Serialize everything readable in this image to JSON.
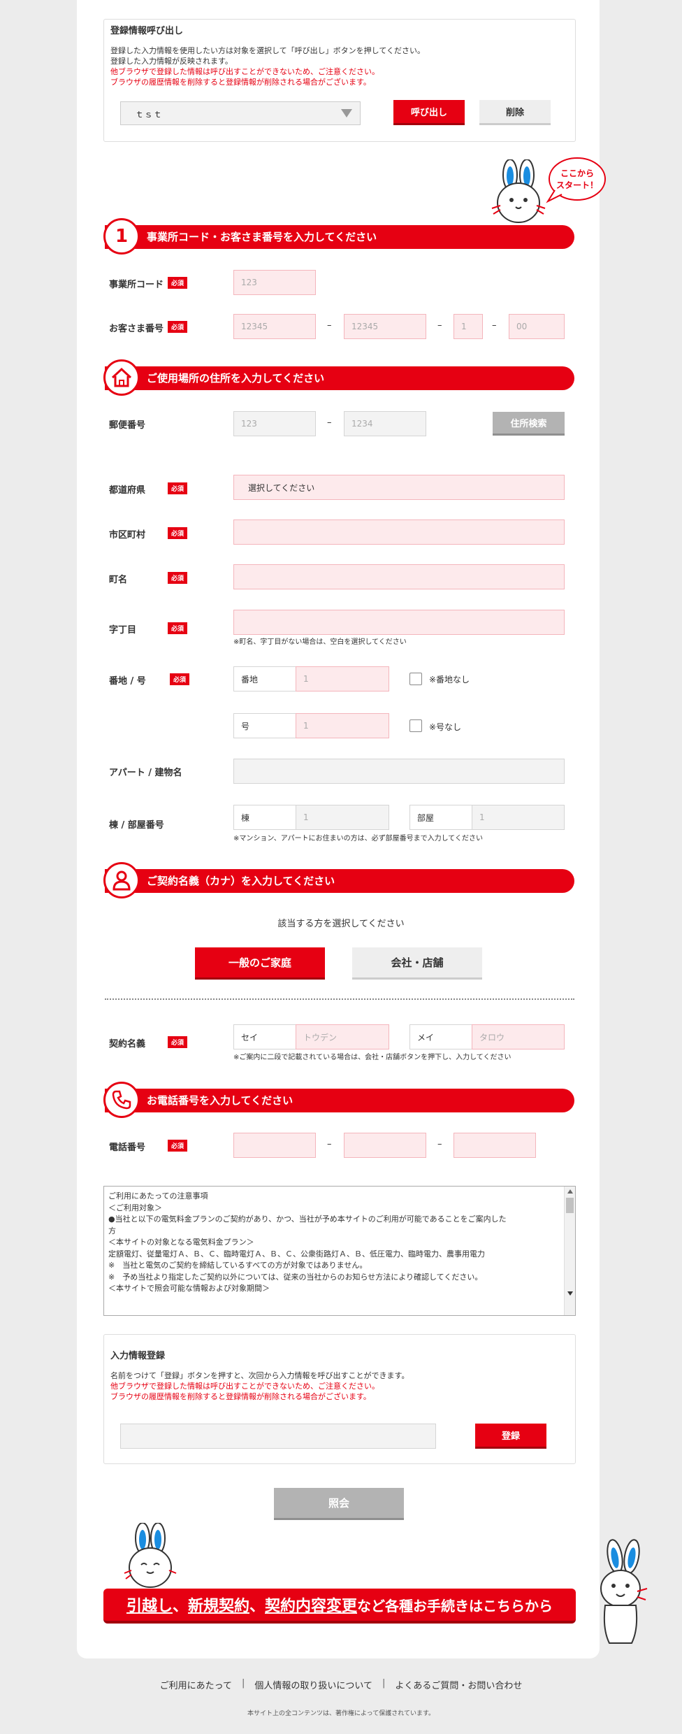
{
  "recall": {
    "title": "登録情報呼び出し",
    "note_black_1": "登録した入力情報を使用したい方は対象を選択して「呼び出し」ボタンを押してください。",
    "note_black_2": "登録した入力情報が反映されます。",
    "note_red_1": "他ブラウザで登録した情報は呼び出すことができないため、ご注意ください。",
    "note_red_2": "ブラウザの履歴情報を削除すると登録情報が削除される場合がございます。",
    "select_value": "ｔｓｔ",
    "call_button": "呼び出し",
    "delete_button": "削除"
  },
  "bubble": {
    "line1": "ここから",
    "line2": "スタート！"
  },
  "sections": {
    "s1": {
      "num": "1",
      "title": "事業所コード・お客さま番号を入力してください"
    },
    "s2": {
      "title": "ご使用場所の住所を入力してください"
    },
    "s3": {
      "title": "ご契約名義（カナ）を入力してください"
    },
    "s4": {
      "title": "お電話番号を入力してください"
    }
  },
  "required_badge": "必須",
  "dash": "–",
  "office": {
    "label": "事業所コード",
    "placeholder": "123"
  },
  "customer": {
    "label": "お客さま番号",
    "p1": "12345",
    "p2": "12345",
    "p3": "1",
    "p4": "00"
  },
  "postal": {
    "label": "郵便番号",
    "p1": "123",
    "p2": "1234",
    "search_button": "住所検索"
  },
  "prefecture": {
    "label": "都道府県",
    "value": "選択してください"
  },
  "city": {
    "label": "市区町村"
  },
  "town": {
    "label": "町名"
  },
  "chome": {
    "label": "字丁目",
    "hint": "※町名、字丁目がない場合は、空白を選択してください"
  },
  "banchi": {
    "label": "番地 / 号",
    "banchi_prefix": "番地",
    "banchi_placeholder": "1",
    "no_banchi": "※番地なし",
    "go_prefix": "号",
    "go_placeholder": "1",
    "no_go": "※号なし"
  },
  "building": {
    "label": "アパート / 建物名"
  },
  "room": {
    "label": "棟 / 部屋番号",
    "tou_prefix": "棟",
    "tou_placeholder": "1",
    "heya_prefix": "部屋",
    "heya_placeholder": "1",
    "hint": "※マンション、アパートにお住まいの方は、必ず部屋番号まで入力してください"
  },
  "contract": {
    "select_prompt": "該当する方を選択してください",
    "btn_home": "一般のご家庭",
    "btn_company": "会社・店舗",
    "label": "契約名義",
    "sei_prefix": "セイ",
    "sei_placeholder": "トウデン",
    "mei_prefix": "メイ",
    "mei_placeholder": "タロウ",
    "hint": "※ご案内に二段で記載されている場合は、会社・店舗ボタンを押下し、入力してください"
  },
  "phone": {
    "label": "電話番号"
  },
  "terms": {
    "lines": [
      "ご利用にあたっての注意事項",
      "",
      "＜ご利用対象＞",
      "●当社と以下の電気料金プランのご契約があり、かつ、当社が予め本サイトのご利用が可能であることをご案内した",
      "方",
      "＜本サイトの対象となる電気料金プラン＞",
      "定額電灯、従量電灯Ａ、Ｂ、Ｃ、臨時電灯Ａ、Ｂ、Ｃ、公衆街路灯Ａ、Ｂ、低圧電力、臨時電力、農事用電力",
      "※　当社と電気のご契約を締結しているすべての方が対象ではありません。",
      "※　予め当社より指定したご契約以外については、従来の当社からのお知らせ方法により確認してください。",
      "",
      "＜本サイトで照会可能な情報および対象期間＞"
    ]
  },
  "register": {
    "title": "入力情報登録",
    "note_black": "名前をつけて「登録」ボタンを押すと、次回から入力情報を呼び出すことができます。",
    "note_red_1": "他ブラウザで登録した情報は呼び出すことができないため、ご注意ください。",
    "note_red_2": "ブラウザの履歴情報を削除すると登録情報が削除される場合がございます。",
    "button": "登録"
  },
  "submit_button": "照会",
  "banner": {
    "p1": "引越し",
    "p2": "、",
    "p3": "新規契約",
    "p4": "、",
    "p5": "契約内容変更",
    "p6": "など各種お手続きはこちらから"
  },
  "footer": {
    "link1": "ご利用にあたって",
    "link2": "個人情報の取り扱いについて",
    "link3": "よくあるご質問・お問い合わせ",
    "copyright": "本サイト上の全コンテンツは、著作権によって保護されています。"
  },
  "colors": {
    "brand_red": "#e60012",
    "input_pink": "#fdeaec",
    "background": "#ececec"
  }
}
